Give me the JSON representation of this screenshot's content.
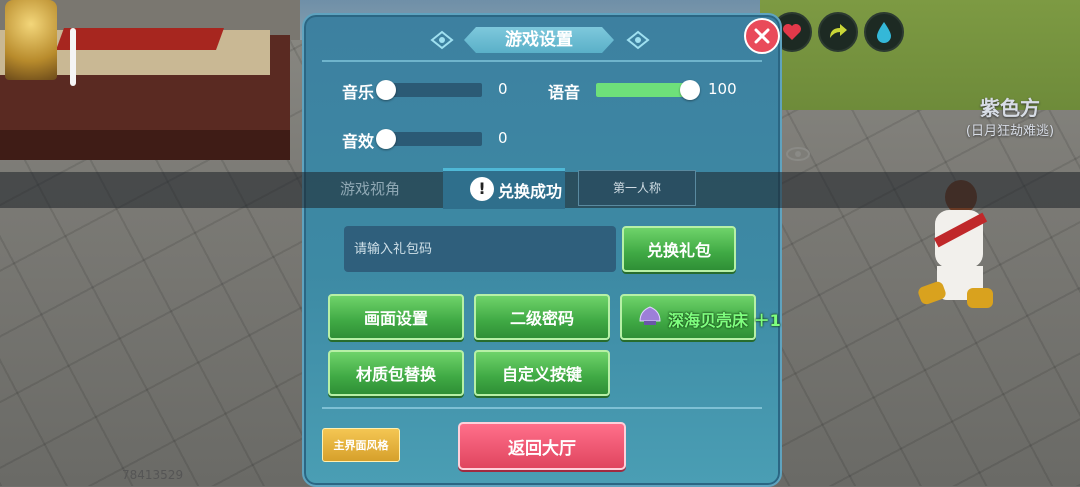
{
  "scene": {
    "team_label": "紫色方",
    "team_subtitle": "(日月狂劫难逃)",
    "player_id": "78413529"
  },
  "hud": {
    "icons": [
      "heart-icon",
      "arrow-icon",
      "water-drop-icon"
    ]
  },
  "settings": {
    "title": "游戏设置",
    "music": {
      "label": "音乐",
      "value": "0",
      "level": 0
    },
    "voice": {
      "label": "语音",
      "value": "100",
      "level": 1
    },
    "sfx": {
      "label": "音效",
      "value": "0",
      "level": 0
    },
    "view": {
      "label": "游戏视角",
      "first_person": "第一人称"
    },
    "toast": "兑换成功",
    "gift": {
      "placeholder": "请输入礼包码",
      "redeem_label": "兑换礼包"
    },
    "buttons": {
      "graphics": "画面设置",
      "second_password": "二级密码",
      "texture_pack": "材质包替换",
      "custom_keys": "自定义按键"
    },
    "reward_toast": "深海贝壳床 ＋1",
    "ui_style": "主界面风格",
    "back_lobby": "返回大厅"
  },
  "colors": {
    "panel": "#3d80a0",
    "button_green": "#3fa944",
    "button_pink": "#e0455f",
    "button_gold": "#d6a02b",
    "slider_fill": "#6ee07a",
    "close_red": "#e94a5a"
  }
}
